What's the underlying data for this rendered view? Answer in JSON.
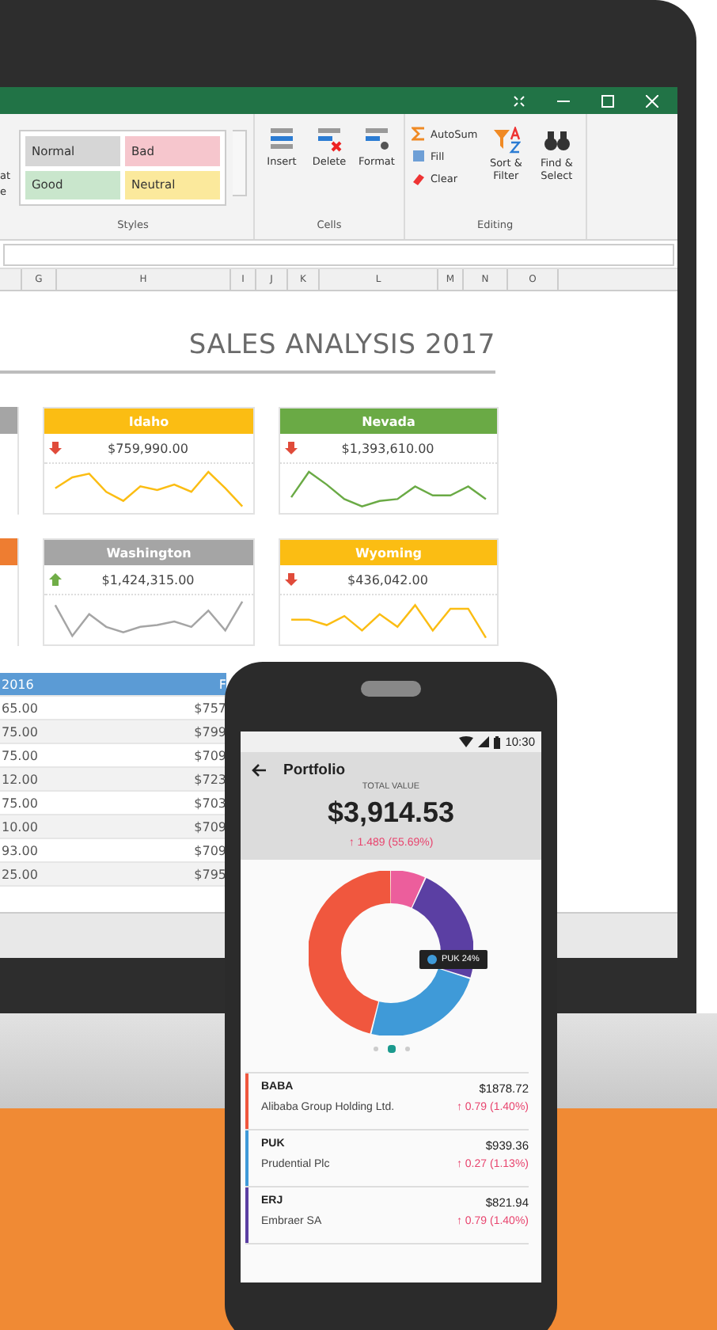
{
  "ribbon": {
    "cut_labels": [
      "at",
      "e"
    ],
    "styles": [
      {
        "label": "Normal",
        "color": "#d6d6d6"
      },
      {
        "label": "Bad",
        "color": "#f6c6cd"
      },
      {
        "label": "Good",
        "color": "#c9e6cc"
      },
      {
        "label": "Neutral",
        "color": "#fbe99c"
      }
    ],
    "groups": [
      "Styles",
      "Cells",
      "Editing"
    ],
    "cells_buttons": [
      "Insert",
      "Delete",
      "Format"
    ],
    "editing_small": [
      "AutoSum",
      "Fill",
      "Clear"
    ],
    "editing_large": [
      "Sort & Filter",
      "Find & Select"
    ]
  },
  "column_headers": [
    "G",
    "H",
    "I",
    "J",
    "K",
    "L",
    "M",
    "N",
    "O"
  ],
  "sheet": {
    "title": "SALES ANALYSIS 2017",
    "cards": [
      {
        "kind": "partial",
        "color": "#a5a5a5"
      },
      {
        "kind": "full",
        "title": "Idaho",
        "color": "#fbbd13",
        "rising": false,
        "value": "$759,990.00"
      },
      {
        "kind": "full",
        "title": "Nevada",
        "color": "#6aaa45",
        "rising": false,
        "value": "$1,393,610.00"
      },
      {
        "kind": "partial",
        "color": "#ee7d31"
      },
      {
        "kind": "full",
        "title": "Washington",
        "color": "#a5a5a5",
        "rising": true,
        "value": "$1,424,315.00"
      },
      {
        "kind": "full",
        "title": "Wyoming",
        "color": "#fbbd13",
        "rising": false,
        "value": "$436,042.00"
      }
    ],
    "table": {
      "columns": [
        "2016",
        "F"
      ],
      "rows": [
        [
          "65.00",
          "$757"
        ],
        [
          "75.00",
          "$799"
        ],
        [
          "75.00",
          "$709"
        ],
        [
          "12.00",
          "$723"
        ],
        [
          "75.00",
          "$703"
        ],
        [
          "10.00",
          "$709"
        ],
        [
          "93.00",
          "$709"
        ],
        [
          "25.00",
          "$795"
        ]
      ]
    }
  },
  "phone": {
    "time": "10:30",
    "title": "Portfolio",
    "total_label": "TOTAL VALUE",
    "total": "$3,914.53",
    "change": "↑ 1.489 (55.69%)",
    "tooltip": "PUK 24%",
    "pager": [
      {
        "selected": false
      },
      {
        "selected": true
      },
      {
        "selected": false
      }
    ],
    "holdings": [
      {
        "symbol": "BABA",
        "name": "Alibaba Group Holding Ltd.",
        "price": "$1878.72",
        "change": "↑ 0.79 (1.40%)",
        "color": "#f0573e"
      },
      {
        "symbol": "PUK",
        "name": "Prudential Plc",
        "price": "$939.36",
        "change": "↑ 0.27 (1.13%)",
        "color": "#3f9ad8"
      },
      {
        "symbol": "ERJ",
        "name": "Embraer SA",
        "price": "$821.94",
        "change": "↑ 0.79 (1.40%)",
        "color": "#5b3fa3"
      }
    ]
  }
}
